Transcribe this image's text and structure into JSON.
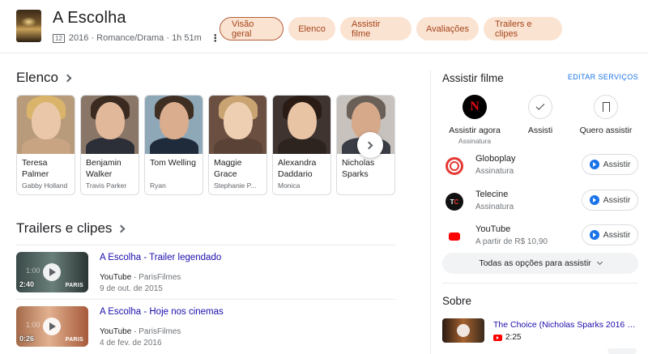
{
  "header": {
    "title": "A Escolha",
    "rating": "12",
    "meta": "2016 · Romance/Drama · 1h 51m",
    "tabs": [
      {
        "label": "Visão geral",
        "active": true
      },
      {
        "label": "Elenco"
      },
      {
        "label": "Assistir filme"
      },
      {
        "label": "Avaliações"
      },
      {
        "label": "Trailers e clipes"
      }
    ]
  },
  "cast": {
    "title": "Elenco",
    "members": [
      {
        "name_line1": "Teresa",
        "name_line2": "Palmer",
        "role": "Gabby Holland"
      },
      {
        "name_line1": "Benjamin",
        "name_line2": "Walker",
        "role": "Travis Parker"
      },
      {
        "name_line1": "Tom Welling",
        "name_line2": "",
        "role": "Ryan"
      },
      {
        "name_line1": "Maggie",
        "name_line2": "Grace",
        "role": "Stephanie P..."
      },
      {
        "name_line1": "Alexandra",
        "name_line2": "Daddario",
        "role": "Monica"
      },
      {
        "name_line1": "Nicholas",
        "name_line2": "Sparks",
        "role": ""
      }
    ]
  },
  "trailers": {
    "title": "Trailers e clipes",
    "items": [
      {
        "title": "A Escolha - Trailer legendado",
        "duration": "2:40",
        "ghost": "1:00",
        "source": "YouTube",
        "channel": "ParisFilmes",
        "date": "9 de out. de 2015",
        "brand": "PARIS"
      },
      {
        "title": "A Escolha - Hoje nos cinemas",
        "duration": "0:26",
        "ghost": "1:00",
        "source": "YouTube",
        "channel": "ParisFilmes",
        "date": "4 de fev. de 2016",
        "brand": "PARIS"
      }
    ]
  },
  "watch": {
    "title": "Assistir filme",
    "edit_label": "EDITAR SERVIÇOS",
    "quick": [
      {
        "label": "Assistir agora",
        "sub": "Assinatura",
        "icon": "netflix-icon"
      },
      {
        "label": "Assisti",
        "sub": "",
        "icon": "check-icon"
      },
      {
        "label": "Quero assistir",
        "sub": "",
        "icon": "bookmark-icon"
      }
    ],
    "providers": [
      {
        "name": "Globoplay",
        "sub": "Assinatura",
        "button": "Assistir"
      },
      {
        "name": "Telecine",
        "sub": "Assinatura",
        "button": "Assistir"
      },
      {
        "name": "YouTube",
        "sub": "A partir de R$ 10,90",
        "button": "Assistir"
      }
    ],
    "all_options": "Todas as opções para assistir"
  },
  "about": {
    "title": "Sobre",
    "video_title": "The Choice (Nicholas Sparks 2016 M...",
    "video_duration": "2:25"
  },
  "colors": {
    "chip_bg": "#fbe3d2",
    "chip_text": "#a4451a",
    "link": "#1a0dab",
    "accent": "#1a73e8"
  }
}
